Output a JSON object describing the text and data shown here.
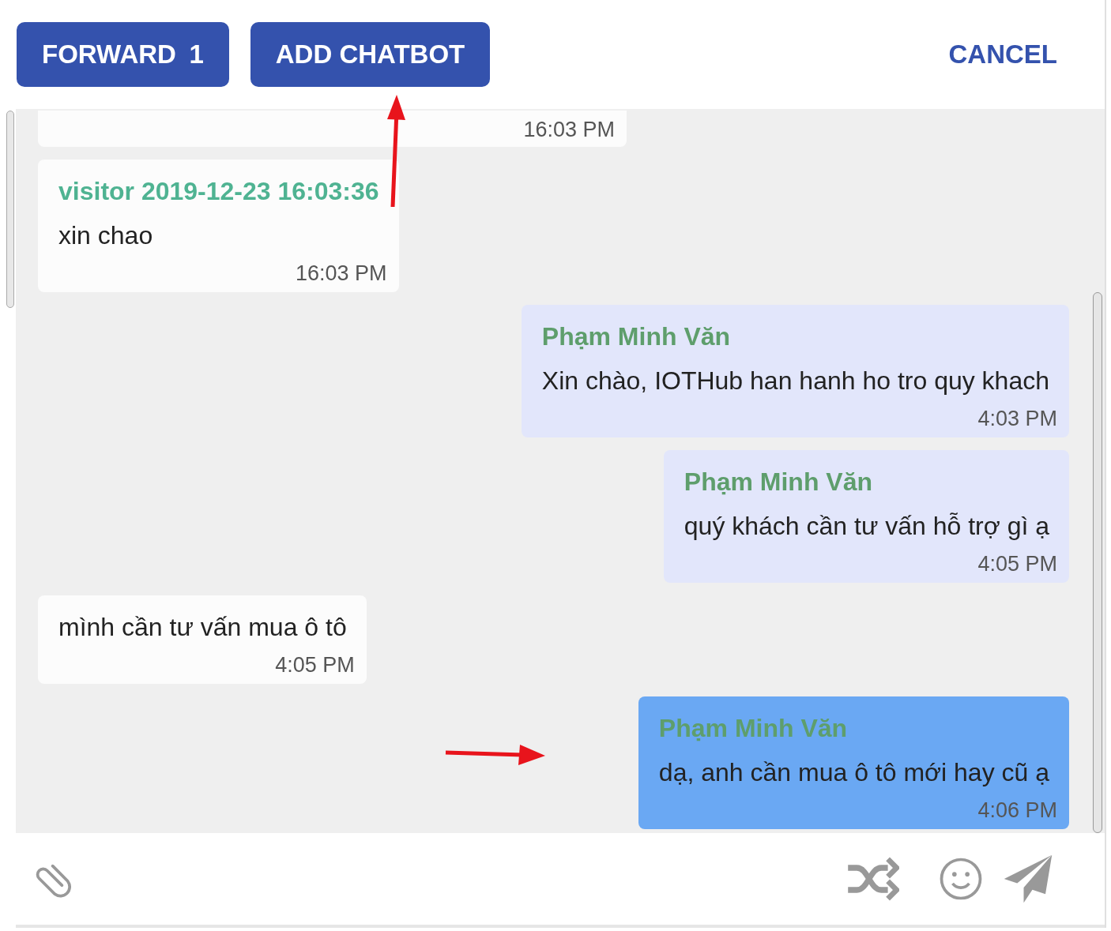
{
  "header": {
    "buttons": [
      {
        "label": "FORWARD",
        "count": "1"
      },
      {
        "label": "ADD CHATBOT"
      }
    ],
    "cancel": "CANCEL"
  },
  "messages": [
    {
      "kind": "visitor",
      "time": "16:03 PM",
      "selected": false,
      "partial": true
    },
    {
      "kind": "visitor",
      "sender": "visitor 2019-12-23 16:03:36",
      "text": "xin chao",
      "time": "16:03 PM",
      "selected": false
    },
    {
      "kind": "agent",
      "sender": "Phạm Minh Văn",
      "text": "Xin chào, IOTHub han hanh ho tro quy khach",
      "time": "4:03 PM",
      "selected": false
    },
    {
      "kind": "agent",
      "sender": "Phạm Minh Văn",
      "text": "quý khách cần tư vấn hỗ trợ gì ạ",
      "time": "4:05 PM",
      "selected": false
    },
    {
      "kind": "visitor",
      "text": "mình cần tư vấn mua ô tô",
      "time": "4:05 PM",
      "selected": false
    },
    {
      "kind": "agent",
      "sender": "Phạm Minh Văn",
      "text": "dạ, anh cần mua ô tô mới hay cũ ạ",
      "time": "4:06 PM",
      "selected": true
    }
  ]
}
